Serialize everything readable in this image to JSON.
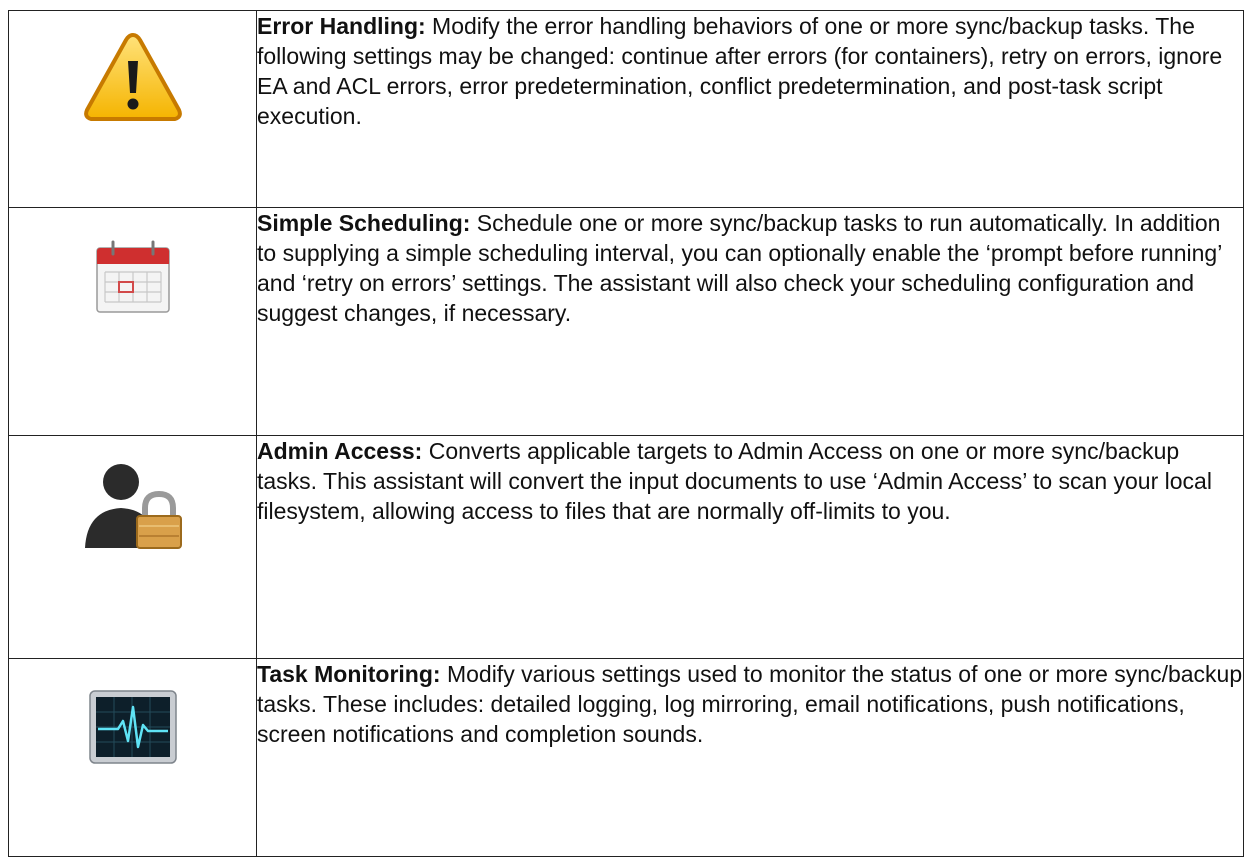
{
  "rows": [
    {
      "icon": "warning-icon",
      "title": "Error Handling:",
      "text": " Modify the error handling behaviors of one or more sync/backup tasks. The following settings may be changed: continue after errors (for containers), retry on errors, ignore EA and ACL errors, error predetermination, conflict predetermination, and post-task script execution."
    },
    {
      "icon": "calendar-icon",
      "title": "Simple Scheduling:",
      "text": " Schedule one or more sync/backup tasks to run automatically. In addition to supplying a simple scheduling interval, you can optionally enable the ‘prompt before running’ and ‘retry on errors’ settings. The assistant will also check your scheduling configuration and suggest changes, if necessary."
    },
    {
      "icon": "admin-user-lock-icon",
      "title": "Admin Access:",
      "text": " Converts applicable targets to Admin Access on one or more sync/backup tasks. This assistant will convert the input documents to use ‘Admin Access’ to scan your local filesystem, allowing access to files that are normally off-limits to you."
    },
    {
      "icon": "activity-monitor-icon",
      "title": "Task Monitoring:",
      "text": " Modify various settings used to monitor the status of one or more sync/backup tasks. These includes: detailed logging, log mirroring, email notifications, push notifications, screen notifications and completion sounds."
    }
  ]
}
